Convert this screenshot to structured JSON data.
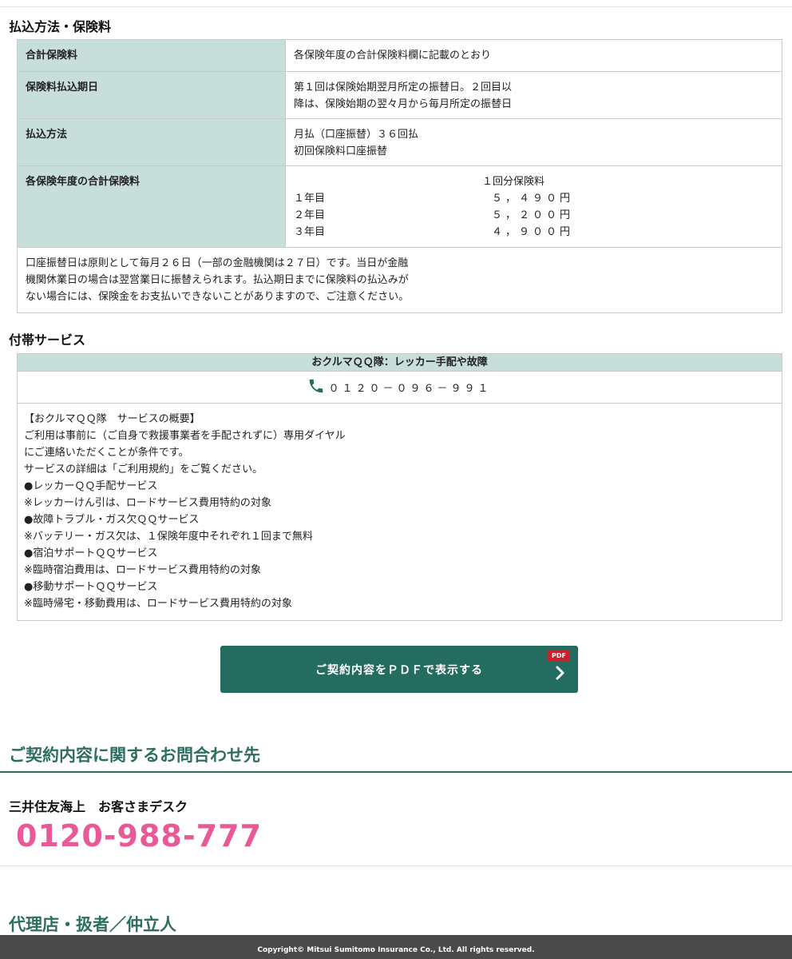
{
  "payment": {
    "title": "払込方法・保険料",
    "rows": [
      {
        "label": "合計保険料",
        "lines": [
          "各保険年度の合計保険料欄に記載のとおり"
        ]
      },
      {
        "label": "保険料払込期日",
        "lines": [
          "第１回は保険始期翌月所定の振替日。２回目以",
          "降は、保険始期の翌々月から毎月所定の振替日"
        ]
      },
      {
        "label": "払込方法",
        "lines": [
          "月払（口座振替）３６回払",
          "初回保険料口座振替"
        ]
      }
    ],
    "yearly": {
      "label": "各保険年度の合計保険料",
      "header": "１回分保険料",
      "years": [
        {
          "year": "１年目",
          "amount": "５，４９０円"
        },
        {
          "year": "２年目",
          "amount": "５，２００円"
        },
        {
          "year": "３年目",
          "amount": "４，９００円"
        }
      ]
    },
    "note": [
      "口座振替日は原則として毎月２６日（一部の金融機関は２７日）です。当日が金融",
      "機関休業日の場合は翌営業日に振替えられます。払込期日までに保険料の払込みが",
      "ない場合には、保険金をお支払いできないことがありますので、ご注意ください。"
    ]
  },
  "services": {
    "title": "付帯サービス",
    "head": "おクルマＱＱ隊：レッカー手配や故障",
    "phone": "０１２０－０９６－９９１",
    "body": [
      "【おクルマＱＱ隊　サービスの概要】",
      "ご利用は事前に（ご自身で救援事業者を手配されずに）専用ダイヤル",
      "にご連絡いただくことが条件です。",
      "サービスの詳細は「ご利用規約」をご覧ください。",
      "●レッカーＱＱ手配サービス",
      "※レッカーけん引は、ロードサービス費用特約の対象",
      "●故障トラブル・ガス欠ＱＱサービス",
      "※バッテリー・ガス欠は、１保険年度中それぞれ１回まで無料",
      "●宿泊サポートＱＱサービス",
      "※臨時宿泊費用は、ロードサービス費用特約の対象",
      "●移動サポートＱＱサービス",
      "※臨時帰宅・移動費用は、ロードサービス費用特約の対象"
    ]
  },
  "pdf_button": {
    "label": "ご契約内容をＰＤＦで表示する",
    "badge": "PDF",
    "icon": "chevron-right-icon"
  },
  "contact": {
    "title": "ご契約内容に関するお問合わせ先",
    "desk": "三井住友海上　お客さまデスク",
    "phone": "0120-988-777"
  },
  "agency": {
    "title": "代理店・扱者／仲立人"
  },
  "footer": {
    "copyright": "Copyright© Mitsui Sumitomo Insurance Co., Ltd. All rights reserved."
  },
  "colors": {
    "accent": "#236c5f",
    "table_header": "#c8dedb",
    "phone_pink": "#e85a97",
    "pdf_badge": "#c9202a",
    "footer_bg": "#4a4a4a"
  }
}
